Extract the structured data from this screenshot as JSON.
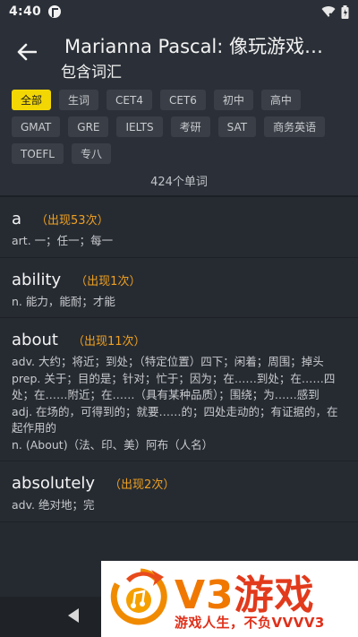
{
  "status": {
    "time": "4:40"
  },
  "header": {
    "title": "Marianna Pascal: 像玩游戏…",
    "subtitle": "包含词汇"
  },
  "filters": {
    "rows": [
      [
        "全部",
        "生词",
        "CET4",
        "CET6",
        "初中",
        "高中"
      ],
      [
        "GMAT",
        "GRE",
        "IELTS",
        "考研",
        "SAT",
        "商务英语"
      ],
      [
        "TOEFL",
        "专八"
      ]
    ],
    "active": "全部"
  },
  "word_count": "424个单词",
  "words": [
    {
      "word": "a",
      "occ": "（出现53次）",
      "defs": [
        "art. 一；任一；每一"
      ]
    },
    {
      "word": "ability",
      "occ": "（出现1次）",
      "defs": [
        "n. 能力，能耐；才能"
      ]
    },
    {
      "word": "about",
      "occ": "（出现11次）",
      "defs": [
        "adv. 大约；将近；到处；（特定位置）四下；闲着；周围；掉头",
        "prep. 关于；目的是；针对；忙于；因为；在……到处；在……四处；在……附近；在……（具有某种品质）；围绕；为……感到",
        "adj. 在场的，可得到的；就要……的；四处走动的；有证据的，在起作用的",
        "n. (About)（法、印、美）阿布（人名）"
      ]
    },
    {
      "word": "absolutely",
      "occ": "（出现2次）",
      "defs": [
        "adv. 绝对地；完"
      ]
    }
  ],
  "watermark": {
    "brand_v3": "V3",
    "brand_yx": "游戏",
    "slogan": "游戏人生，不负VVVV3"
  },
  "colors": {
    "accent": "#f2d705",
    "occurrence": "#f0a020",
    "background": "#252a31"
  }
}
